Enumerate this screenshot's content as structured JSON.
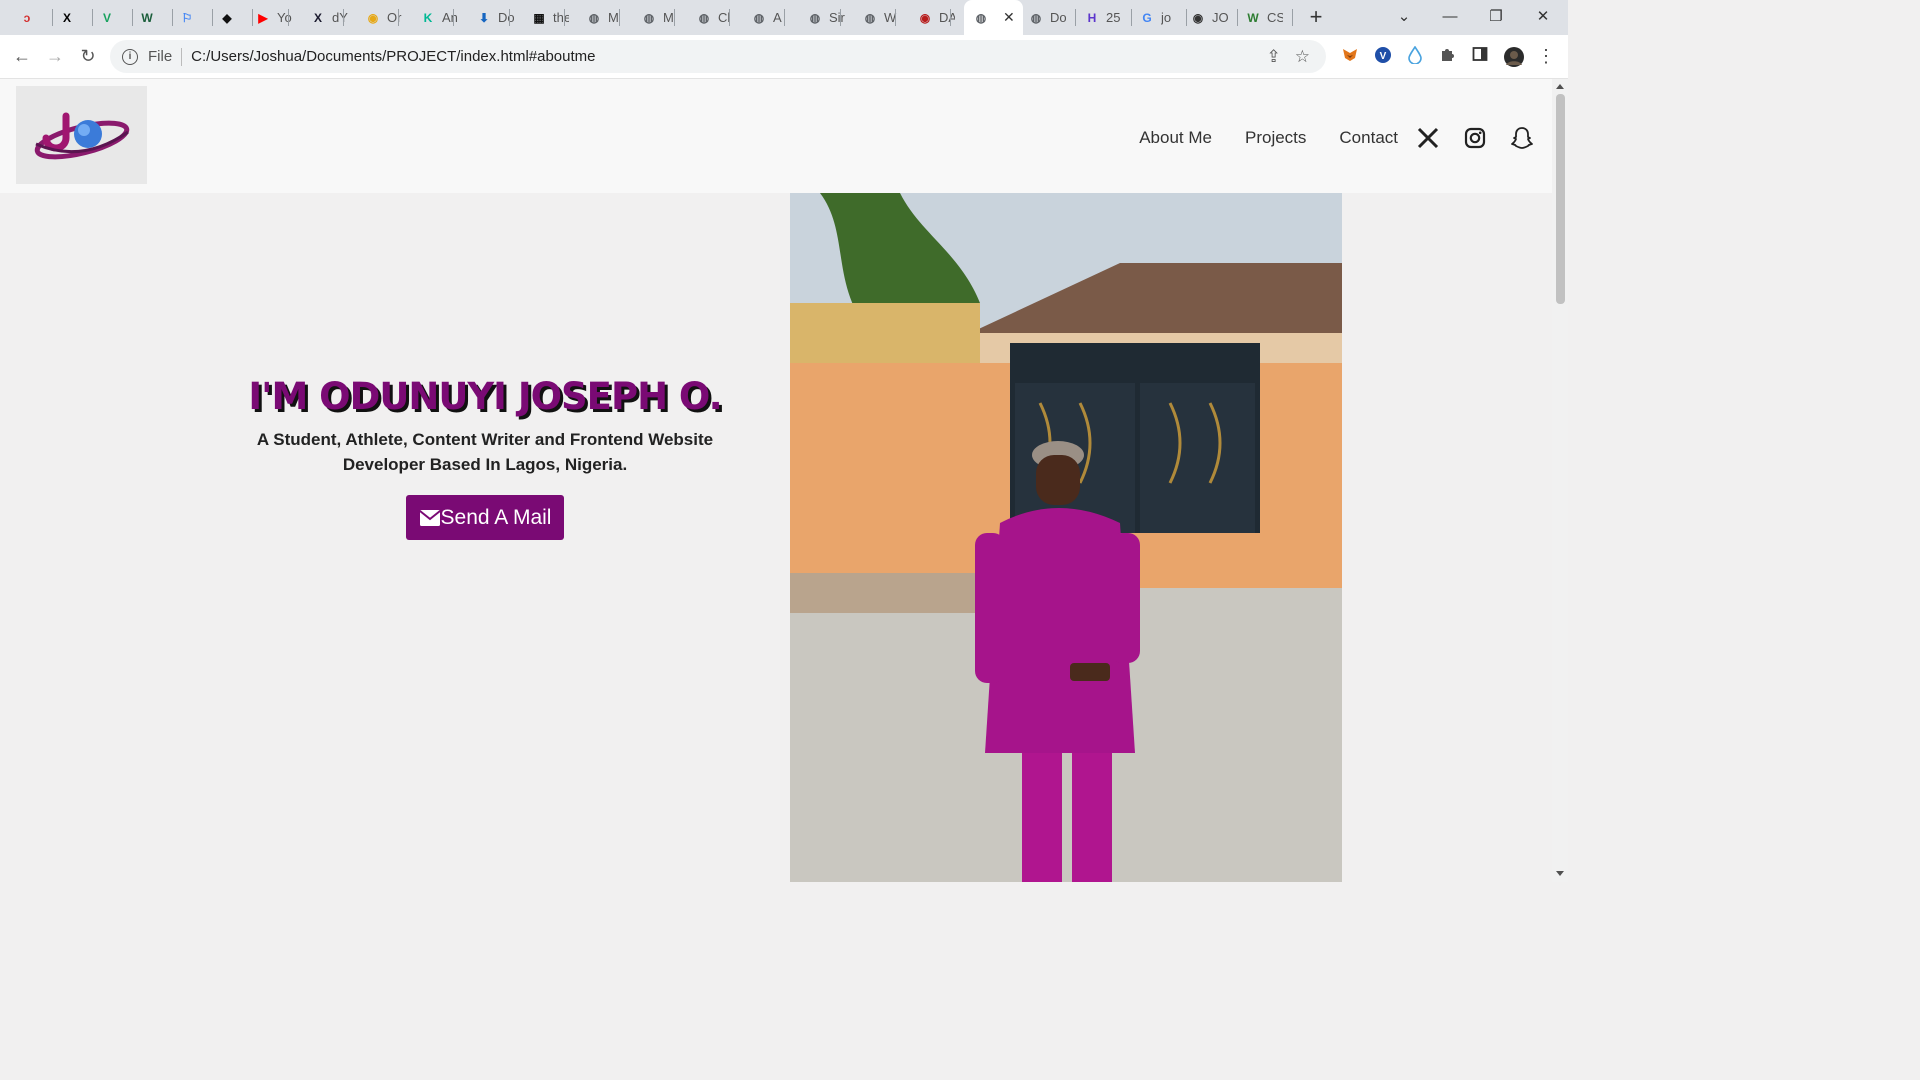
{
  "browser": {
    "tabs": [
      {
        "favicon_glyph": "ↄ",
        "favicon_color": "#d32f2f",
        "title": ""
      },
      {
        "favicon_glyph": "X",
        "favicon_color": "#000000",
        "title": ""
      },
      {
        "favicon_glyph": "V",
        "favicon_color": "#1aa260",
        "title": ""
      },
      {
        "favicon_glyph": "W",
        "favicon_color": "#1b5e3b",
        "title": ""
      },
      {
        "favicon_glyph": "⚐",
        "favicon_color": "#4285f4",
        "title": ""
      },
      {
        "favicon_glyph": "◆",
        "favicon_color": "#111111",
        "title": ""
      },
      {
        "favicon_glyph": "▶",
        "favicon_color": "#ff0000",
        "title": "Yo"
      },
      {
        "favicon_glyph": "X",
        "favicon_color": "#1a1a2e",
        "title": "dY"
      },
      {
        "favicon_glyph": "◉",
        "favicon_color": "#e6a817",
        "title": "Or"
      },
      {
        "favicon_glyph": "K",
        "favicon_color": "#00b894",
        "title": "An"
      },
      {
        "favicon_glyph": "⬇",
        "favicon_color": "#1565c0",
        "title": "Do"
      },
      {
        "favicon_glyph": "▦",
        "favicon_color": "#111111",
        "title": "the"
      },
      {
        "favicon_glyph": "◍",
        "favicon_color": "#5f6368",
        "title": "M"
      },
      {
        "favicon_glyph": "◍",
        "favicon_color": "#5f6368",
        "title": "M"
      },
      {
        "favicon_glyph": "◍",
        "favicon_color": "#5f6368",
        "title": "Cl"
      },
      {
        "favicon_glyph": "◍",
        "favicon_color": "#5f6368",
        "title": "A"
      },
      {
        "favicon_glyph": "◍",
        "favicon_color": "#5f6368",
        "title": "Sir"
      },
      {
        "favicon_glyph": "◍",
        "favicon_color": "#5f6368",
        "title": "W"
      },
      {
        "favicon_glyph": "◉",
        "favicon_color": "#b71c1c",
        "title": "DA"
      }
    ],
    "active_tab": {
      "favicon_glyph": "◍",
      "favicon_color": "#5f6368",
      "title": ""
    },
    "tabs_after": [
      {
        "favicon_glyph": "◍",
        "favicon_color": "#5f6368",
        "title": "Do"
      },
      {
        "favicon_glyph": "H",
        "favicon_color": "#5c35cc",
        "title": "25"
      },
      {
        "favicon_glyph": "G",
        "favicon_color": "#4285f4",
        "title": "jo"
      },
      {
        "favicon_glyph": "◉",
        "favicon_color": "#333333",
        "title": "JO"
      },
      {
        "favicon_glyph": "W",
        "favicon_color": "#2e7d32",
        "title": "CS"
      }
    ],
    "new_tab": "+",
    "window_controls": {
      "tab_list": "⌄",
      "minimize": "—",
      "restore": "❐",
      "close": "✕"
    },
    "nav": {
      "back": "←",
      "forward": "→",
      "reload": "↻"
    },
    "address": {
      "scheme_label": "File",
      "url": "C:/Users/Joshua/Documents/PROJECT/index.html#aboutme"
    },
    "omnibox_icons": {
      "share": "⇪",
      "bookmark": "☆"
    },
    "extensions": [
      "metamask-icon",
      "vpn-icon",
      "droplet-icon",
      "puzzle-icon",
      "sidepanel-icon",
      "profile-avatar",
      "kebab-menu-icon"
    ]
  },
  "site": {
    "nav": {
      "about": "About Me",
      "projects": "Projects",
      "contact": "Contact"
    },
    "socials": [
      "x-icon",
      "instagram-icon",
      "snapchat-icon"
    ],
    "hero": {
      "title": "I'M ODUNUYI JOSEPH O.",
      "subtitle": "A Student, Athlete, Content Writer and Frontend Website Developer Based In Lagos, Nigeria.",
      "button_label": "Send A Mail"
    },
    "colors": {
      "accent": "#7a0a74",
      "photo_outfit": "#b0158f",
      "wall": "#e8a86a"
    }
  }
}
